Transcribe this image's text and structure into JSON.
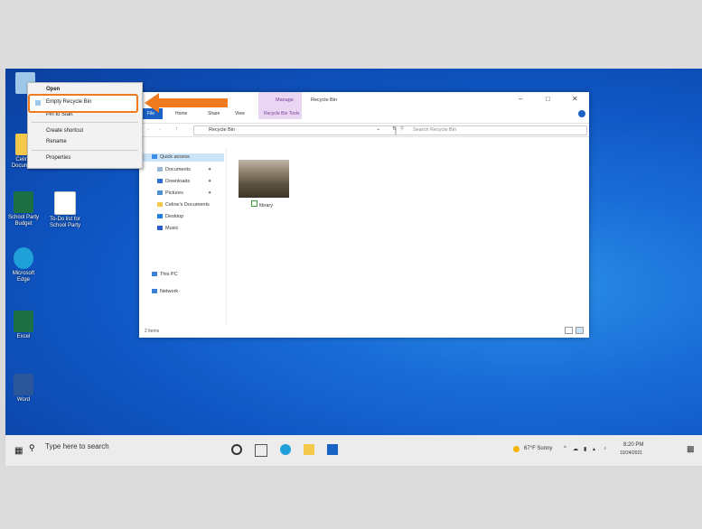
{
  "desktop": {
    "icons": [
      {
        "label": "Recycle Bin",
        "color": "#9ec7e8"
      },
      {
        "label": "Celine's Documents",
        "color": "#f4c84a"
      },
      {
        "label": "School Party Budget",
        "color": "#1d7044"
      },
      {
        "label": "To-Do list for School Party",
        "color": "#ffffff"
      },
      {
        "label": "Microsoft Edge",
        "color": "#1fa0d8"
      },
      {
        "label": "Excel",
        "color": "#1d7044"
      },
      {
        "label": "Word",
        "color": "#2b579a"
      }
    ]
  },
  "context_menu": {
    "items": [
      "Open",
      "Empty Recycle Bin",
      "Pin to Start",
      "Create shortcut",
      "Rename",
      "Properties"
    ]
  },
  "explorer": {
    "manage_tab": "Manage",
    "title": "Recycle Bin",
    "ribbon_tabs": [
      "File",
      "Home",
      "Share",
      "View",
      "Recycle Bin Tools"
    ],
    "address": "Recycle Bin",
    "search_placeholder": "Search Recycle Bin",
    "nav": {
      "quick_access": "Quick access",
      "documents": "Documents",
      "downloads": "Downloads",
      "pictures": "Pictures",
      "celines_documents": "Celine's Documents",
      "desktop": "Desktop",
      "music": "Music",
      "this_pc": "This PC",
      "network": "Network"
    },
    "file_label": "library",
    "status": "2 items"
  },
  "taskbar": {
    "search_placeholder": "Type here to search",
    "weather": "67°F Sunny",
    "time": "8:20 PM",
    "date": "10/24/2021"
  },
  "colors": {
    "accent": "#1a63c5",
    "highlight": "#f07a1e",
    "manage": "#e8d6f2"
  }
}
